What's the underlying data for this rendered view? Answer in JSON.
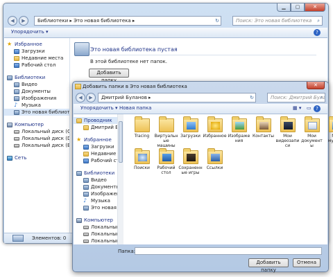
{
  "main": {
    "address": "Библиотеки ▸ Это новая библиотека ▸",
    "search_placeholder": "Поиск: Это новая библиотека",
    "toolbar": {
      "organize": "Упорядочить ▾"
    },
    "nav": {
      "favorites": {
        "label": "Избранное",
        "items": [
          "Загрузки",
          "Недавние места",
          "Рабочий стол"
        ]
      },
      "libraries": {
        "label": "Библиотеки",
        "items": [
          "Видео",
          "Документы",
          "Изображения",
          "Музыка",
          "Это новая библиоте"
        ]
      },
      "computer": {
        "label": "Компьютер",
        "items": [
          "Локальный диск (C",
          "Локальный диск (D",
          "Локальный диск (E"
        ]
      },
      "network": {
        "label": "Сеть"
      }
    },
    "library": {
      "title": "Это новая библиотека пустая",
      "message": "В этой библиотеке нет папок.",
      "add_button": "Добавить папку"
    },
    "status": "Элементов: 0"
  },
  "dialog": {
    "title": "Добавить папки в Это новая библиотека",
    "address": "Дмитрий Буланов ▸",
    "search_placeholder": "Поиск: Дмитрий Буланов",
    "toolbar": {
      "organize": "Упорядочить ▾",
      "new_folder": "Новая папка"
    },
    "nav": {
      "explorer": {
        "label": "Проводник",
        "items": [
          "Дмитрий Буланов"
        ]
      },
      "favorites": {
        "label": "Избранное",
        "items": [
          "Загрузки",
          "Недавние места",
          "Рабочий стол"
        ]
      },
      "libraries": {
        "label": "Библиотеки",
        "items": [
          "Видео",
          "Документы",
          "Изображения",
          "Музыка",
          "Это новая библиот"
        ]
      },
      "computer": {
        "label": "Компьютер",
        "items": [
          "Локальный диск",
          "Локальный диск",
          "Локальный диск"
        ]
      }
    },
    "folders": [
      {
        "label": "Tracing",
        "icon": "folder"
      },
      {
        "label": "Виртуальные машины",
        "icon": "folder"
      },
      {
        "label": "Загрузки",
        "icon": "downloads"
      },
      {
        "label": "Избранное",
        "icon": "favorites"
      },
      {
        "label": "Изображения",
        "icon": "pictures"
      },
      {
        "label": "Контакты",
        "icon": "contacts"
      },
      {
        "label": "Мои видеозаписи",
        "icon": "videos"
      },
      {
        "label": "Мои документы",
        "icon": "documents"
      },
      {
        "label": "Моя музыка",
        "icon": "music"
      },
      {
        "label": "Поиски",
        "icon": "searches"
      },
      {
        "label": "Рабочий стол",
        "icon": "desktop"
      },
      {
        "label": "Сохраненные игры",
        "icon": "games"
      },
      {
        "label": "Ссылки",
        "icon": "links"
      }
    ],
    "folder_label": "Папка:",
    "folder_value": "",
    "add_button": "Добавить папку",
    "cancel_button": "Отмена"
  },
  "colors": {
    "accent": "#1e3287",
    "title_bar": "#b9d0ea",
    "close": "#c4412c"
  }
}
